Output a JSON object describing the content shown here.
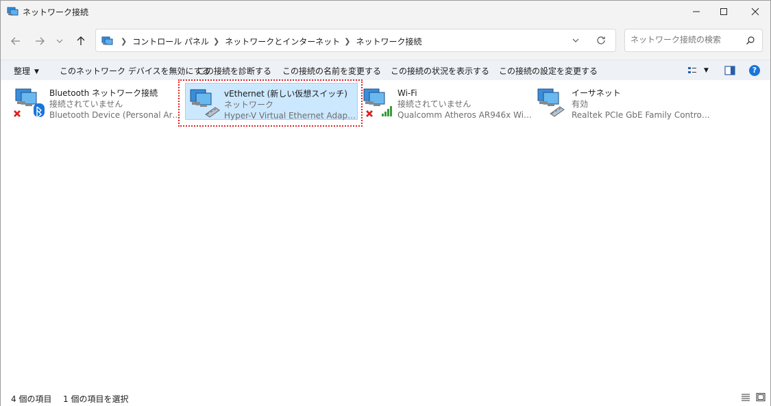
{
  "window": {
    "title": "ネットワーク接続",
    "controls": {
      "minimize": "minimize-icon",
      "maximize": "maximize-icon",
      "close": "close-icon"
    }
  },
  "address": {
    "breadcrumbs": [
      "コントロール パネル",
      "ネットワークとインターネット",
      "ネットワーク接続"
    ]
  },
  "search": {
    "placeholder": "ネットワーク接続の検索"
  },
  "commands": {
    "organize": "整理",
    "disable": "このネットワーク デバイスを無効にする",
    "diagnose": "この接続を診断する",
    "rename": "この接続の名前を変更する",
    "status": "この接続の状況を表示する",
    "settings": "この接続の設定を変更する"
  },
  "connections": [
    {
      "name": "Bluetooth ネットワーク接続",
      "status": "接続されていません",
      "device": "Bluetooth Device (Personal Area ...",
      "icon": "bluetooth-network-icon",
      "badge": "disconnected-x-icon",
      "selected": false
    },
    {
      "name": "vEthernet (新しい仮想スイッチ)",
      "status": "ネットワーク",
      "device": "Hyper-V Virtual Ethernet Adapter ...",
      "icon": "ethernet-network-icon",
      "selected": true
    },
    {
      "name": "Wi-Fi",
      "status": "接続されていません",
      "device": "Qualcomm Atheros AR946x Wirel...",
      "icon": "wifi-network-icon",
      "badge": "disconnected-x-icon",
      "selected": false
    },
    {
      "name": "イーサネット",
      "status": "有効",
      "device": "Realtek PCIe GbE Family Controller",
      "icon": "ethernet-network-icon",
      "selected": false
    }
  ],
  "statusbar": {
    "item_count": "4 個の項目",
    "selected_count": "1 個の項目を選択"
  },
  "colors": {
    "accent": "#1a74d9",
    "selection_bg": "#cce8ff",
    "selection_border": "#99d1ff",
    "focus_ring": "#e02020",
    "error_x": "#e02020"
  }
}
